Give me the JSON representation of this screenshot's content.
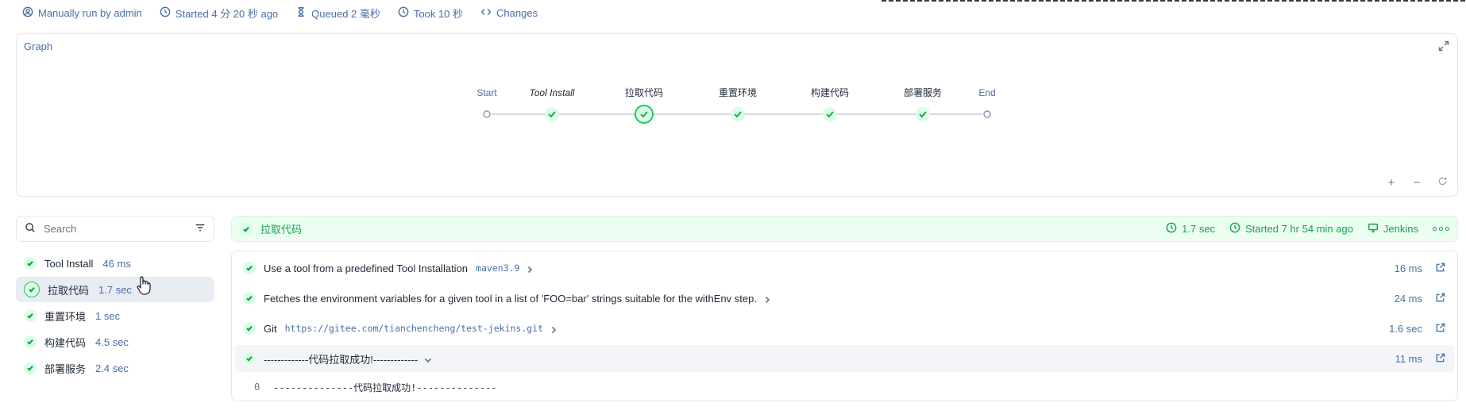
{
  "topbar": {
    "run_by": "Manually run by admin",
    "started": "Started 4 分 20 秒 ago",
    "queued": "Queued 2 毫秒",
    "took": "Took 10 秒",
    "changes": "Changes"
  },
  "graph": {
    "title": "Graph",
    "nodes": [
      {
        "label": "Start",
        "kind": "terminal",
        "italic": false
      },
      {
        "label": "Tool Install",
        "kind": "success",
        "italic": true
      },
      {
        "label": "拉取代码",
        "kind": "selected",
        "italic": false
      },
      {
        "label": "重置环境",
        "kind": "success",
        "italic": false
      },
      {
        "label": "构建代码",
        "kind": "success",
        "italic": false
      },
      {
        "label": "部署服务",
        "kind": "success",
        "italic": false
      },
      {
        "label": "End",
        "kind": "terminal",
        "italic": false
      }
    ],
    "zoom": {
      "in": "+",
      "out": "−"
    }
  },
  "search": {
    "placeholder": "Search"
  },
  "stages": [
    {
      "name": "Tool Install",
      "duration": "46 ms"
    },
    {
      "name": "拉取代码",
      "duration": "1.7 sec"
    },
    {
      "name": "重置环境",
      "duration": "1 sec"
    },
    {
      "name": "构建代码",
      "duration": "4.5 sec"
    },
    {
      "name": "部署服务",
      "duration": "2.4 sec"
    }
  ],
  "selected_stage": {
    "title": "拉取代码",
    "duration": "1.7 sec",
    "started": "Started 7 hr 54 min ago",
    "agent": "Jenkins"
  },
  "steps": [
    {
      "label": "Use a tool from a predefined Tool Installation",
      "code": "maven3.9",
      "duration": "16 ms"
    },
    {
      "label": "Fetches the environment variables for a given tool in a list of 'FOO=bar' strings suitable for the withEnv step.",
      "code": "",
      "duration": "24 ms"
    },
    {
      "label": "Git",
      "code": "https://gitee.com/tianchencheng/test-jekins.git",
      "duration": "1.6 sec"
    },
    {
      "label": "-------------代码拉取成功!-------------",
      "code": "",
      "duration": "11 ms"
    }
  ],
  "log": {
    "line_number": "0",
    "text": "--------------代码拉取成功!--------------"
  },
  "colors": {
    "accent": "#4a6fa5",
    "success": "#16a34a",
    "success_bg": "#dcfce7"
  }
}
